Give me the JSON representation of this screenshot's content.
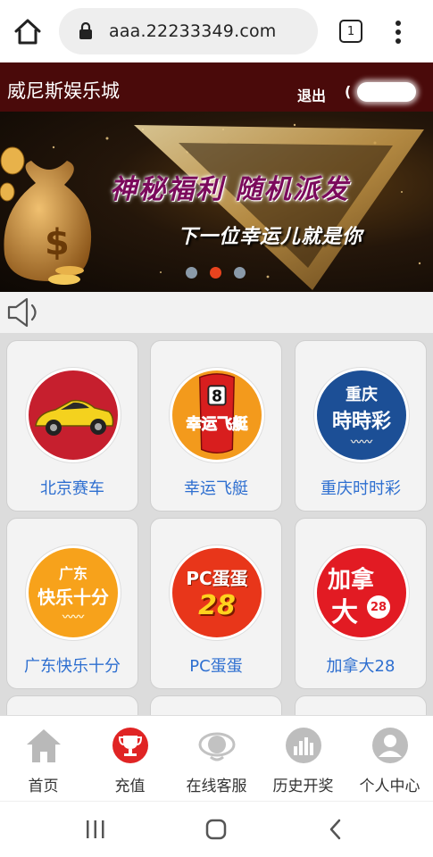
{
  "browser": {
    "url": "aaa.22233349.com",
    "tab_count": "1"
  },
  "header": {
    "title": "威尼斯娱乐城",
    "logout_label": "退出",
    "user_prefix": "("
  },
  "banner": {
    "line1": "神秘福利 随机派发",
    "line2": "下一位幸运儿就是你",
    "slide_count": 3,
    "active_slide": 2
  },
  "games": [
    {
      "label": "北京赛车",
      "icon": "race-car-icon"
    },
    {
      "label": "幸运飞艇",
      "icon": "speedboat-icon"
    },
    {
      "label": "重庆时时彩",
      "icon": "chongqing-ssc-icon",
      "badge_line1": "重庆",
      "badge_line2": "時時彩"
    },
    {
      "label": "广东快乐十分",
      "icon": "guangdong-happy-ten-icon",
      "badge_line1": "广东",
      "badge_line2": "快乐十分"
    },
    {
      "label": "PC蛋蛋",
      "icon": "pc-egg-icon",
      "badge_line1": "PC蛋蛋",
      "badge_line2": "28"
    },
    {
      "label": "加拿大28",
      "icon": "canada-28-icon",
      "badge_line1": "加拿",
      "badge_line2": "大",
      "badge_num": "28"
    }
  ],
  "lucky_boat_text": "幸运飞艇",
  "boat_number": "8",
  "bottom_nav": [
    {
      "label": "首页",
      "icon": "home-icon"
    },
    {
      "label": "充值",
      "icon": "trophy-icon"
    },
    {
      "label": "在线客服",
      "icon": "customer-service-icon"
    },
    {
      "label": "历史开奖",
      "icon": "history-chart-icon"
    },
    {
      "label": "个人中心",
      "icon": "user-icon"
    }
  ],
  "colors": {
    "header_bg": "#4a0a0a",
    "link_blue": "#2e6fd0",
    "grid_bg": "#dcdcdc",
    "active_dot": "#e8431e"
  }
}
